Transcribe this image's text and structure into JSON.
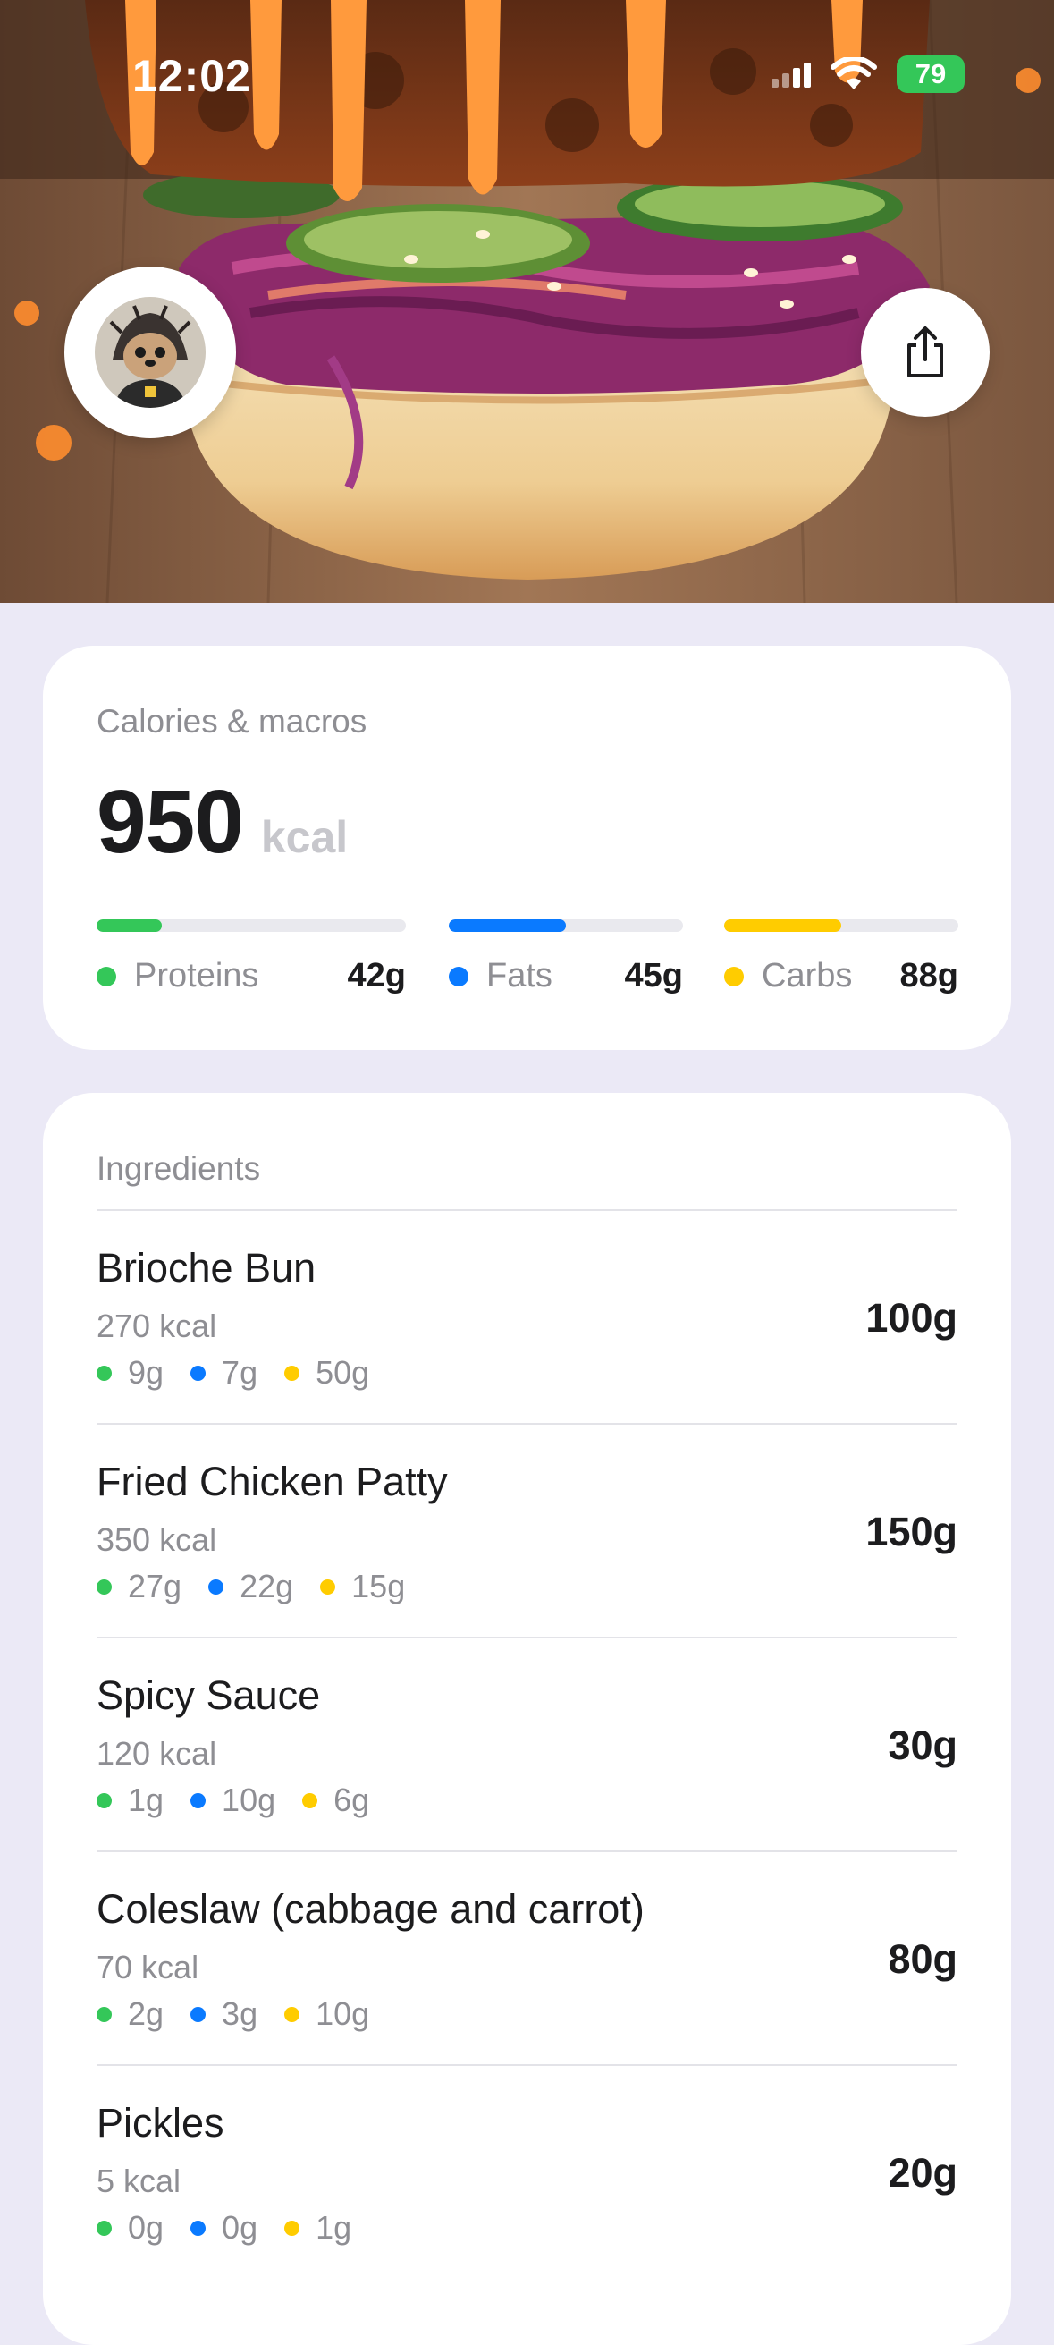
{
  "status_bar": {
    "time": "12:02",
    "battery": "79"
  },
  "colors": {
    "protein": "#34c759",
    "fat": "#0a7aff",
    "carb": "#ffcc00",
    "background": "#ebe9f6"
  },
  "icons": {
    "avatar": "hedgehog-avatar-icon",
    "share": "share-icon",
    "wifi": "wifi-icon",
    "signal": "signal-icon"
  },
  "macros": {
    "title": "Calories & macros",
    "calories": "950",
    "unit": "kcal",
    "proteins": {
      "label": "Proteins",
      "value": "42g",
      "fill": 0.21
    },
    "fats": {
      "label": "Fats",
      "value": "45g",
      "fill": 0.5
    },
    "carbs": {
      "label": "Carbs",
      "value": "88g",
      "fill": 0.5
    }
  },
  "ingredients": {
    "title": "Ingredients",
    "items": [
      {
        "name": "Brioche Bun",
        "kcal": "270 kcal",
        "protein": "9g",
        "fat": "7g",
        "carb": "50g",
        "weight": "100g"
      },
      {
        "name": "Fried Chicken Patty",
        "kcal": "350 kcal",
        "protein": "27g",
        "fat": "22g",
        "carb": "15g",
        "weight": "150g"
      },
      {
        "name": "Spicy Sauce",
        "kcal": "120 kcal",
        "protein": "1g",
        "fat": "10g",
        "carb": "6g",
        "weight": "30g"
      },
      {
        "name": "Coleslaw (cabbage and carrot)",
        "kcal": "70 kcal",
        "protein": "2g",
        "fat": "3g",
        "carb": "10g",
        "weight": "80g"
      },
      {
        "name": "Pickles",
        "kcal": "5 kcal",
        "protein": "0g",
        "fat": "0g",
        "carb": "1g",
        "weight": "20g"
      }
    ]
  }
}
